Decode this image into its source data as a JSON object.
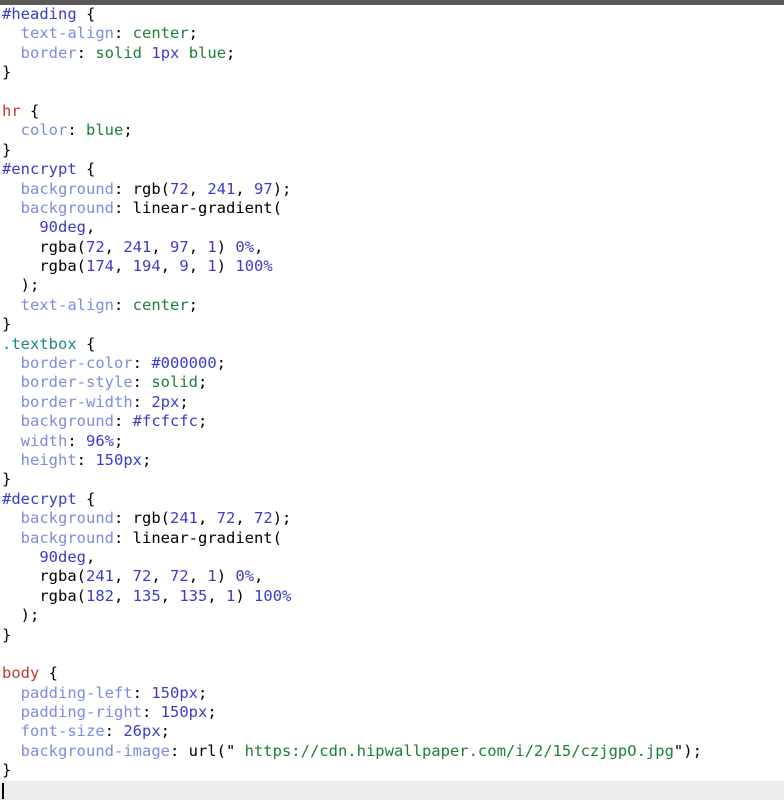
{
  "editor": {
    "language": "css",
    "top_bar_color": "#5a5a5a",
    "background_color": "#ffffff",
    "active_line_color": "#ececec",
    "caret": "|",
    "token_colors": {
      "id_selector": "#3b3bcc",
      "tag_selector": "#c0392b",
      "class_selector": "#1a8a8a",
      "property": "#7c8ce0",
      "value_keyword": "#1a7f37",
      "number": "#3b3bcc",
      "punctuation": "#000000"
    }
  },
  "lines": [
    {
      "n": 1,
      "tokens": [
        {
          "t": "id",
          "v": "#heading"
        },
        {
          "t": "plain",
          "v": " {"
        }
      ]
    },
    {
      "n": 2,
      "tokens": [
        {
          "t": "plain",
          "v": "  "
        },
        {
          "t": "prop",
          "v": "text-align"
        },
        {
          "t": "plain",
          "v": ": "
        },
        {
          "t": "value",
          "v": "center"
        },
        {
          "t": "plain",
          "v": ";"
        }
      ]
    },
    {
      "n": 3,
      "tokens": [
        {
          "t": "plain",
          "v": "  "
        },
        {
          "t": "prop",
          "v": "border"
        },
        {
          "t": "plain",
          "v": ": "
        },
        {
          "t": "value",
          "v": "solid"
        },
        {
          "t": "plain",
          "v": " "
        },
        {
          "t": "num",
          "v": "1px"
        },
        {
          "t": "plain",
          "v": " "
        },
        {
          "t": "value",
          "v": "blue"
        },
        {
          "t": "plain",
          "v": ";"
        }
      ]
    },
    {
      "n": 4,
      "tokens": [
        {
          "t": "plain",
          "v": "}"
        }
      ]
    },
    {
      "n": 5,
      "tokens": []
    },
    {
      "n": 6,
      "tokens": [
        {
          "t": "tag",
          "v": "hr"
        },
        {
          "t": "plain",
          "v": " {"
        }
      ]
    },
    {
      "n": 7,
      "tokens": [
        {
          "t": "plain",
          "v": "  "
        },
        {
          "t": "prop",
          "v": "color"
        },
        {
          "t": "plain",
          "v": ": "
        },
        {
          "t": "value",
          "v": "blue"
        },
        {
          "t": "plain",
          "v": ";"
        }
      ]
    },
    {
      "n": 8,
      "tokens": [
        {
          "t": "plain",
          "v": "}"
        }
      ]
    },
    {
      "n": 9,
      "tokens": [
        {
          "t": "id",
          "v": "#encrypt"
        },
        {
          "t": "plain",
          "v": " {"
        }
      ]
    },
    {
      "n": 10,
      "tokens": [
        {
          "t": "plain",
          "v": "  "
        },
        {
          "t": "prop",
          "v": "background"
        },
        {
          "t": "plain",
          "v": ": rgb("
        },
        {
          "t": "num",
          "v": "72"
        },
        {
          "t": "plain",
          "v": ", "
        },
        {
          "t": "num",
          "v": "241"
        },
        {
          "t": "plain",
          "v": ", "
        },
        {
          "t": "num",
          "v": "97"
        },
        {
          "t": "plain",
          "v": ");"
        }
      ]
    },
    {
      "n": 11,
      "tokens": [
        {
          "t": "plain",
          "v": "  "
        },
        {
          "t": "prop",
          "v": "background"
        },
        {
          "t": "plain",
          "v": ": linear-gradient("
        }
      ]
    },
    {
      "n": 12,
      "tokens": [
        {
          "t": "plain",
          "v": "    "
        },
        {
          "t": "num",
          "v": "90deg"
        },
        {
          "t": "plain",
          "v": ","
        }
      ]
    },
    {
      "n": 13,
      "tokens": [
        {
          "t": "plain",
          "v": "    rgba("
        },
        {
          "t": "num",
          "v": "72"
        },
        {
          "t": "plain",
          "v": ", "
        },
        {
          "t": "num",
          "v": "241"
        },
        {
          "t": "plain",
          "v": ", "
        },
        {
          "t": "num",
          "v": "97"
        },
        {
          "t": "plain",
          "v": ", "
        },
        {
          "t": "num",
          "v": "1"
        },
        {
          "t": "plain",
          "v": ") "
        },
        {
          "t": "num",
          "v": "0%"
        },
        {
          "t": "plain",
          "v": ","
        }
      ]
    },
    {
      "n": 14,
      "tokens": [
        {
          "t": "plain",
          "v": "    rgba("
        },
        {
          "t": "num",
          "v": "174"
        },
        {
          "t": "plain",
          "v": ", "
        },
        {
          "t": "num",
          "v": "194"
        },
        {
          "t": "plain",
          "v": ", "
        },
        {
          "t": "num",
          "v": "9"
        },
        {
          "t": "plain",
          "v": ", "
        },
        {
          "t": "num",
          "v": "1"
        },
        {
          "t": "plain",
          "v": ") "
        },
        {
          "t": "num",
          "v": "100%"
        }
      ]
    },
    {
      "n": 15,
      "tokens": [
        {
          "t": "plain",
          "v": "  );"
        }
      ]
    },
    {
      "n": 16,
      "tokens": [
        {
          "t": "plain",
          "v": "  "
        },
        {
          "t": "prop",
          "v": "text-align"
        },
        {
          "t": "plain",
          "v": ": "
        },
        {
          "t": "value",
          "v": "center"
        },
        {
          "t": "plain",
          "v": ";"
        }
      ]
    },
    {
      "n": 17,
      "tokens": [
        {
          "t": "plain",
          "v": "}"
        }
      ]
    },
    {
      "n": 18,
      "tokens": [
        {
          "t": "class",
          "v": ".textbox"
        },
        {
          "t": "plain",
          "v": " {"
        }
      ]
    },
    {
      "n": 19,
      "tokens": [
        {
          "t": "plain",
          "v": "  "
        },
        {
          "t": "prop",
          "v": "border-color"
        },
        {
          "t": "plain",
          "v": ": "
        },
        {
          "t": "num",
          "v": "#000000"
        },
        {
          "t": "plain",
          "v": ";"
        }
      ]
    },
    {
      "n": 20,
      "tokens": [
        {
          "t": "plain",
          "v": "  "
        },
        {
          "t": "prop",
          "v": "border-style"
        },
        {
          "t": "plain",
          "v": ": "
        },
        {
          "t": "value",
          "v": "solid"
        },
        {
          "t": "plain",
          "v": ";"
        }
      ]
    },
    {
      "n": 21,
      "tokens": [
        {
          "t": "plain",
          "v": "  "
        },
        {
          "t": "prop",
          "v": "border-width"
        },
        {
          "t": "plain",
          "v": ": "
        },
        {
          "t": "num",
          "v": "2px"
        },
        {
          "t": "plain",
          "v": ";"
        }
      ]
    },
    {
      "n": 22,
      "tokens": [
        {
          "t": "plain",
          "v": "  "
        },
        {
          "t": "prop",
          "v": "background"
        },
        {
          "t": "plain",
          "v": ": "
        },
        {
          "t": "num",
          "v": "#fcfcfc"
        },
        {
          "t": "plain",
          "v": ";"
        }
      ]
    },
    {
      "n": 23,
      "tokens": [
        {
          "t": "plain",
          "v": "  "
        },
        {
          "t": "prop",
          "v": "width"
        },
        {
          "t": "plain",
          "v": ": "
        },
        {
          "t": "num",
          "v": "96%"
        },
        {
          "t": "plain",
          "v": ";"
        }
      ]
    },
    {
      "n": 24,
      "tokens": [
        {
          "t": "plain",
          "v": "  "
        },
        {
          "t": "prop",
          "v": "height"
        },
        {
          "t": "plain",
          "v": ": "
        },
        {
          "t": "num",
          "v": "150px"
        },
        {
          "t": "plain",
          "v": ";"
        }
      ]
    },
    {
      "n": 25,
      "tokens": [
        {
          "t": "plain",
          "v": "}"
        }
      ]
    },
    {
      "n": 26,
      "tokens": [
        {
          "t": "id",
          "v": "#decrypt"
        },
        {
          "t": "plain",
          "v": " {"
        }
      ]
    },
    {
      "n": 27,
      "tokens": [
        {
          "t": "plain",
          "v": "  "
        },
        {
          "t": "prop",
          "v": "background"
        },
        {
          "t": "plain",
          "v": ": rgb("
        },
        {
          "t": "num",
          "v": "241"
        },
        {
          "t": "plain",
          "v": ", "
        },
        {
          "t": "num",
          "v": "72"
        },
        {
          "t": "plain",
          "v": ", "
        },
        {
          "t": "num",
          "v": "72"
        },
        {
          "t": "plain",
          "v": ");"
        }
      ]
    },
    {
      "n": 28,
      "tokens": [
        {
          "t": "plain",
          "v": "  "
        },
        {
          "t": "prop",
          "v": "background"
        },
        {
          "t": "plain",
          "v": ": linear-gradient("
        }
      ]
    },
    {
      "n": 29,
      "tokens": [
        {
          "t": "plain",
          "v": "    "
        },
        {
          "t": "num",
          "v": "90deg"
        },
        {
          "t": "plain",
          "v": ","
        }
      ]
    },
    {
      "n": 30,
      "tokens": [
        {
          "t": "plain",
          "v": "    rgba("
        },
        {
          "t": "num",
          "v": "241"
        },
        {
          "t": "plain",
          "v": ", "
        },
        {
          "t": "num",
          "v": "72"
        },
        {
          "t": "plain",
          "v": ", "
        },
        {
          "t": "num",
          "v": "72"
        },
        {
          "t": "plain",
          "v": ", "
        },
        {
          "t": "num",
          "v": "1"
        },
        {
          "t": "plain",
          "v": ") "
        },
        {
          "t": "num",
          "v": "0%"
        },
        {
          "t": "plain",
          "v": ","
        }
      ]
    },
    {
      "n": 31,
      "tokens": [
        {
          "t": "plain",
          "v": "    rgba("
        },
        {
          "t": "num",
          "v": "182"
        },
        {
          "t": "plain",
          "v": ", "
        },
        {
          "t": "num",
          "v": "135"
        },
        {
          "t": "plain",
          "v": ", "
        },
        {
          "t": "num",
          "v": "135"
        },
        {
          "t": "plain",
          "v": ", "
        },
        {
          "t": "num",
          "v": "1"
        },
        {
          "t": "plain",
          "v": ") "
        },
        {
          "t": "num",
          "v": "100%"
        }
      ]
    },
    {
      "n": 32,
      "tokens": [
        {
          "t": "plain",
          "v": "  );"
        }
      ]
    },
    {
      "n": 33,
      "tokens": [
        {
          "t": "plain",
          "v": "}"
        }
      ]
    },
    {
      "n": 34,
      "tokens": []
    },
    {
      "n": 35,
      "tokens": [
        {
          "t": "tag",
          "v": "body"
        },
        {
          "t": "plain",
          "v": " {"
        }
      ]
    },
    {
      "n": 36,
      "tokens": [
        {
          "t": "plain",
          "v": "  "
        },
        {
          "t": "prop",
          "v": "padding-left"
        },
        {
          "t": "plain",
          "v": ": "
        },
        {
          "t": "num",
          "v": "150px"
        },
        {
          "t": "plain",
          "v": ";"
        }
      ]
    },
    {
      "n": 37,
      "tokens": [
        {
          "t": "plain",
          "v": "  "
        },
        {
          "t": "prop",
          "v": "padding-right"
        },
        {
          "t": "plain",
          "v": ": "
        },
        {
          "t": "num",
          "v": "150px"
        },
        {
          "t": "plain",
          "v": ";"
        }
      ]
    },
    {
      "n": 38,
      "tokens": [
        {
          "t": "plain",
          "v": "  "
        },
        {
          "t": "prop",
          "v": "font-size"
        },
        {
          "t": "plain",
          "v": ": "
        },
        {
          "t": "num",
          "v": "26px"
        },
        {
          "t": "plain",
          "v": ";"
        }
      ]
    },
    {
      "n": 39,
      "tokens": [
        {
          "t": "plain",
          "v": "  "
        },
        {
          "t": "prop",
          "v": "background-image"
        },
        {
          "t": "plain",
          "v": ": url(\" "
        },
        {
          "t": "value",
          "v": "https://cdn.hipwallpaper.com/i/2/15/czjgpO.jpg"
        },
        {
          "t": "plain",
          "v": "\");"
        }
      ]
    },
    {
      "n": 40,
      "tokens": [
        {
          "t": "plain",
          "v": "}"
        }
      ]
    },
    {
      "n": 41,
      "tokens": [],
      "active": true
    }
  ]
}
